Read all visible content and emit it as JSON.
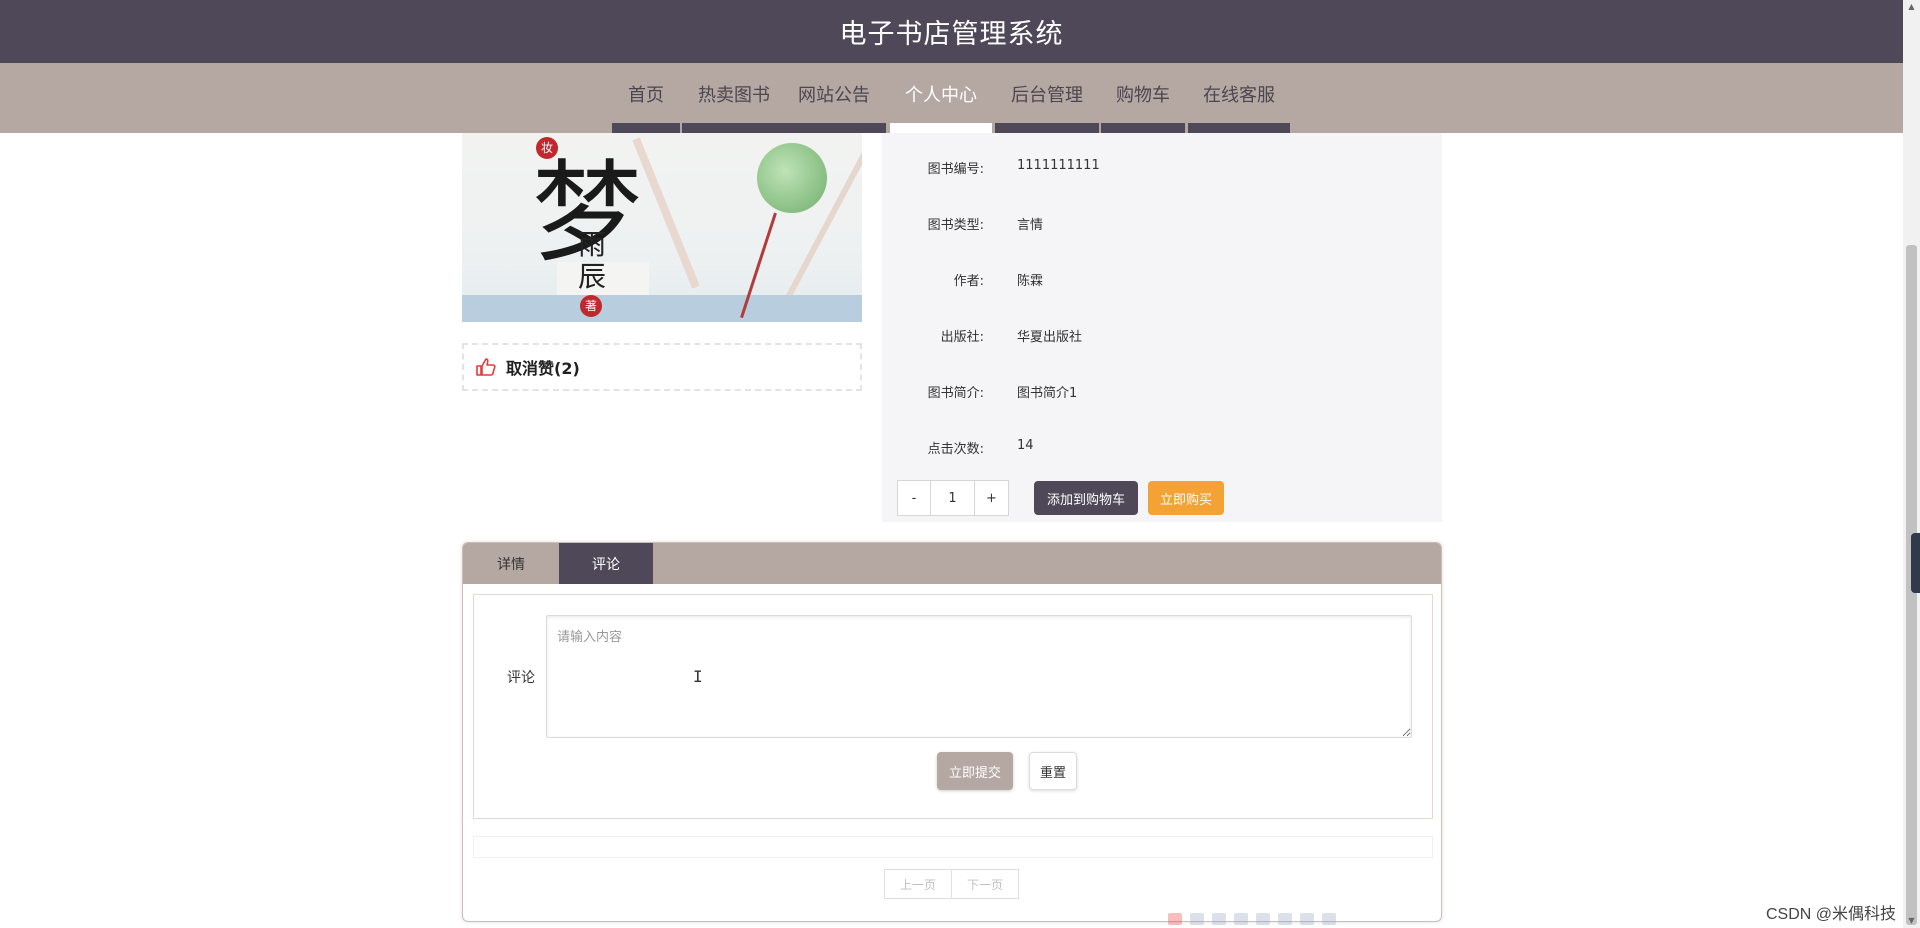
{
  "header": {
    "title": "电子书店管理系统"
  },
  "nav": {
    "items": [
      {
        "label": "首页"
      },
      {
        "label": "热卖图书"
      },
      {
        "label": "网站公告"
      },
      {
        "label": "个人中心"
      },
      {
        "label": "后台管理"
      },
      {
        "label": "购物车"
      },
      {
        "label": "在线客服"
      }
    ],
    "active": "个人中心"
  },
  "cover": {
    "title_char": "梦",
    "side_char": "妆",
    "author_chars": "雨辰",
    "seal_char": "著"
  },
  "like": {
    "label": "取消赞(2)"
  },
  "book": {
    "fields": [
      {
        "key": "图书编号:",
        "value": "1111111111"
      },
      {
        "key": "图书类型:",
        "value": "言情"
      },
      {
        "key": "作者:",
        "value": "陈霖"
      },
      {
        "key": "出版社:",
        "value": "华夏出版社"
      },
      {
        "key": "图书简介:",
        "value": "图书简介1"
      },
      {
        "key": "点击次数:",
        "value": "14"
      }
    ]
  },
  "quantity": {
    "minus": "-",
    "value": "1",
    "plus": "+"
  },
  "actions": {
    "add_to_cart": "添加到购物车",
    "buy_now": "立即购买"
  },
  "tabs": [
    {
      "label": "详情"
    },
    {
      "label": "评论"
    }
  ],
  "active_tab": "评论",
  "comment_form": {
    "label": "评论",
    "placeholder": "请输入内容",
    "submit": "立即提交",
    "reset": "重置"
  },
  "pager": {
    "prev": "上一页",
    "next": "下一页"
  },
  "watermark": "CSDN @米偶科技",
  "colors": {
    "header": "#4f4858",
    "nav": "#b5a8a2",
    "buy": "#f3a234",
    "panel": "#f5f5f7"
  }
}
